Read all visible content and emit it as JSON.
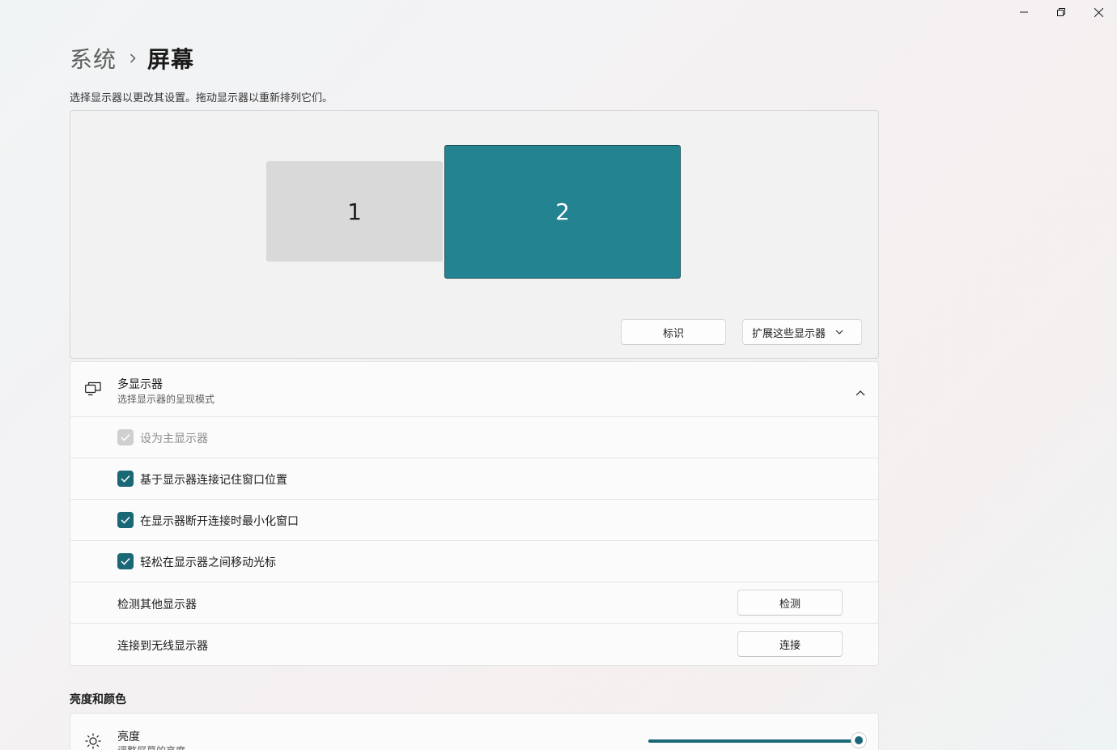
{
  "colors": {
    "accent": "#1a6775",
    "selected_monitor": "#248391",
    "unselected_monitor": "#d9d9d9"
  },
  "window_controls": {
    "minimize": "minimize-icon",
    "maximize": "restore-icon",
    "close": "close-icon"
  },
  "breadcrumb": {
    "parent": "系统",
    "current": "屏幕"
  },
  "hint": "选择显示器以更改其设置。拖动显示器以重新排列它们。",
  "arrangement": {
    "monitors": [
      {
        "label": "1",
        "selected": false
      },
      {
        "label": "2",
        "selected": true
      }
    ],
    "identify_button": "标识",
    "mode_dropdown": "扩展这些显示器"
  },
  "multi_display": {
    "title": "多显示器",
    "subtitle": "选择显示器的呈现模式",
    "expanded": true,
    "checkboxes": [
      {
        "label": "设为主显示器",
        "checked": true,
        "disabled": true
      },
      {
        "label": "基于显示器连接记住窗口位置",
        "checked": true,
        "disabled": false
      },
      {
        "label": "在显示器断开连接时最小化窗口",
        "checked": true,
        "disabled": false
      },
      {
        "label": "轻松在显示器之间移动光标",
        "checked": true,
        "disabled": false
      }
    ],
    "detect": {
      "label": "检测其他显示器",
      "button": "检测"
    },
    "wireless": {
      "label": "连接到无线显示器",
      "button": "连接"
    }
  },
  "brightness_section": {
    "title": "亮度和颜色",
    "brightness": {
      "title": "亮度",
      "subtitle": "调整屏幕的亮度",
      "value": 100
    }
  }
}
